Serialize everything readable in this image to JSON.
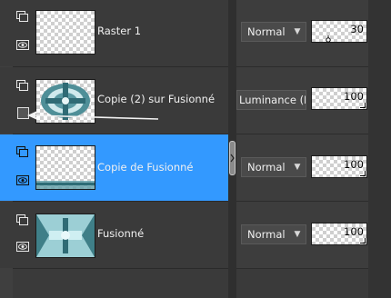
{
  "layers": [
    {
      "name": "Raster 1",
      "blend_mode": "Normal",
      "opacity": "30",
      "selected": false
    },
    {
      "name": "Copie (2) sur Fusionné",
      "blend_mode": "Luminance (H",
      "opacity": "100",
      "selected": false
    },
    {
      "name": "Copie de Fusionné",
      "blend_mode": "Normal",
      "opacity": "100",
      "selected": true
    },
    {
      "name": "Fusionné",
      "blend_mode": "Normal",
      "opacity": "100",
      "selected": false
    }
  ],
  "colors": {
    "selection": "#3399ff",
    "panel": "#3a3a3a",
    "thumb_teal": "#7fb8c0"
  },
  "icons": [
    "layer-group-icon",
    "eye-icon",
    "mask-box-icon",
    "dropdown-caret-icon",
    "arrow-icon"
  ]
}
